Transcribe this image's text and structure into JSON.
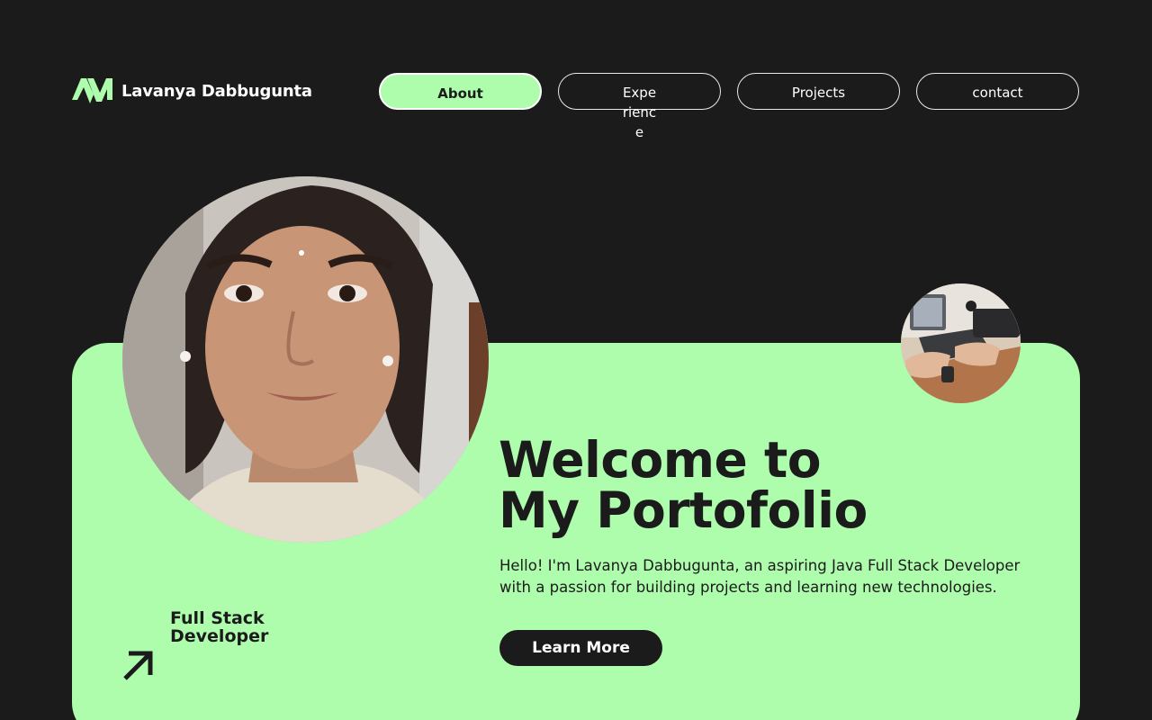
{
  "header": {
    "brand_name": "Lavanya Dabbugunta",
    "logo_icon": "lm-monogram-icon",
    "accent_color": "#aefdad"
  },
  "nav": {
    "items": [
      {
        "label": "About",
        "active": true
      },
      {
        "label": "Experience",
        "active": false
      },
      {
        "label": "Projects",
        "active": false
      },
      {
        "label": "contact",
        "active": false
      }
    ]
  },
  "hero": {
    "headline_line1": "Welcome to",
    "headline_line2": "My Portofolio",
    "intro": "Hello! I'm Lavanya Dabbugunta, an aspiring Java Full Stack Developer with a passion for building projects and learning new technologies.",
    "cta_label": "Learn More",
    "role_line1": "Full Stack",
    "role_line2": "Developer",
    "role_icon": "arrow-up-right-icon",
    "portrait": "profile-photo",
    "thumbnail": "laptop-typing-photo"
  }
}
